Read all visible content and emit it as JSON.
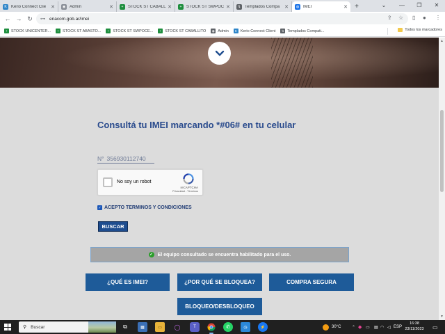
{
  "browser": {
    "tabs": [
      {
        "title": "Kerio Connect Clie",
        "favicon_color": "#2f86c9",
        "favicon": "K"
      },
      {
        "title": "Admin",
        "favicon_color": "#8a8f98",
        "favicon": "◉"
      },
      {
        "title": "STOCK ST CABALL",
        "favicon_color": "#1e8e3e",
        "favicon": "+"
      },
      {
        "title": "STOCK ST SWPOC",
        "favicon_color": "#1e8e3e",
        "favicon": "+"
      },
      {
        "title": "Templados Compa",
        "favicon_color": "#5f6368",
        "favicon": "↯"
      },
      {
        "title": "IMEI",
        "favicon_color": "#1a73e8",
        "favicon": "◍",
        "active": true
      }
    ],
    "new_tab": "+",
    "url": "enacom.gob.ar/imei",
    "bookmarks": [
      {
        "label": "STOCK UNICENTER...",
        "favicon_color": "#1e8e3e",
        "favicon": "+"
      },
      {
        "label": "STOCK ST ABASTO...",
        "favicon_color": "#1e8e3e",
        "favicon": "+"
      },
      {
        "label": "STOCK ST SWPOCE...",
        "favicon_color": "#1e8e3e",
        "favicon": "+"
      },
      {
        "label": "STOCK ST CABALLITO",
        "favicon_color": "#1e8e3e",
        "favicon": "+"
      },
      {
        "label": "Admin",
        "favicon_color": "#5f6368",
        "favicon": "◉"
      },
      {
        "label": "Kerio Connect Client",
        "favicon_color": "#2f86c9",
        "favicon": "K"
      },
      {
        "label": "Templados Compati...",
        "favicon_color": "#5f6368",
        "favicon": "↯"
      }
    ],
    "all_bookmarks": "Todos los marcadores"
  },
  "page": {
    "heading": "Consultá tu IMEI marcando *#06# en tu celular",
    "imei_prefix": "N°",
    "imei_value": "356930112740",
    "captcha": {
      "label": "No soy un robot",
      "brand": "reCAPTCHA",
      "links": "Privacidad - Términos"
    },
    "terms_label": "ACEPTO TERMINOS Y CONDICIONES",
    "terms_checked": true,
    "search_button": "BUSCAR",
    "result_message": "El equipo consultado se encuentra habilitado para el uso.",
    "buttons": {
      "what_is_imei": "¿QUÉ ES IMEI?",
      "why_blocked": "¿POR QUÉ SE BLOQUEA?",
      "safe_purchase": "COMPRA SEGURA",
      "block_unblock": "BLOQUEO/DESBLOQUEO"
    },
    "colors": {
      "heading": "#2a4b8d",
      "button": "#1e5b99",
      "result_bg": "#a5a5a5",
      "success": "#2a9d2a"
    }
  },
  "taskbar": {
    "search_placeholder": "Buscar",
    "weather": "30°C",
    "language": "ESP",
    "time": "16:38",
    "date": "23/11/2023"
  }
}
